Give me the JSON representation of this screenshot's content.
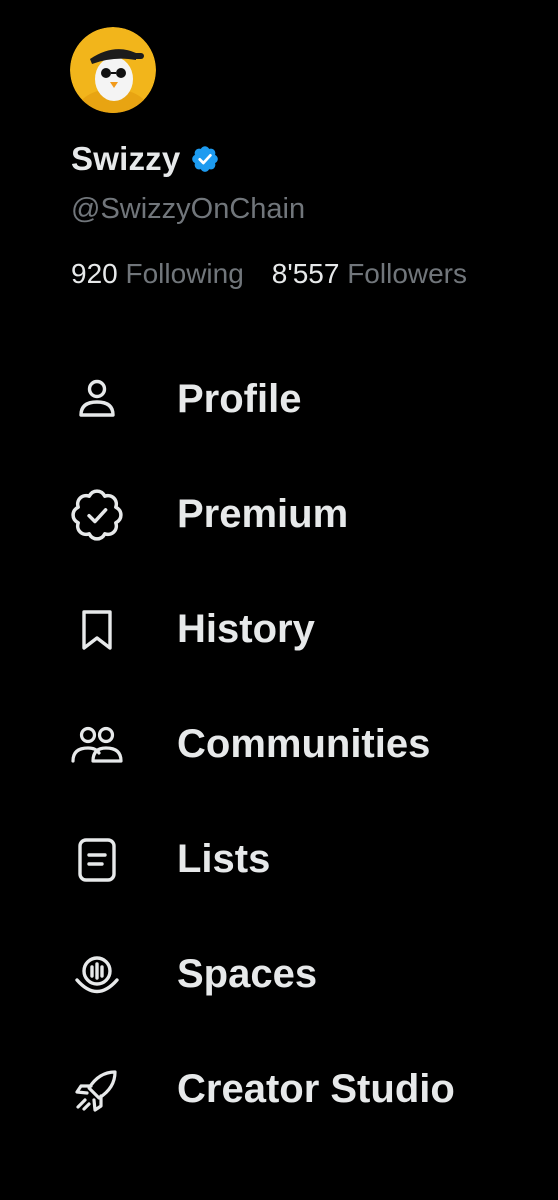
{
  "profile": {
    "display_name": "Swizzy",
    "handle": "@SwizzyOnChain",
    "verified": true,
    "avatar_icon": "penguin-avatar",
    "following_count": "920",
    "following_label": "Following",
    "followers_count": "8'557",
    "followers_label": "Followers"
  },
  "menu": {
    "items": [
      {
        "label": "Profile",
        "icon": "person-icon"
      },
      {
        "label": "Premium",
        "icon": "verified-badge-icon"
      },
      {
        "label": "History",
        "icon": "bookmark-icon"
      },
      {
        "label": "Communities",
        "icon": "people-icon"
      },
      {
        "label": "Lists",
        "icon": "list-icon"
      },
      {
        "label": "Spaces",
        "icon": "microphone-icon"
      },
      {
        "label": "Creator Studio",
        "icon": "rocket-icon"
      }
    ]
  },
  "colors": {
    "background": "#000000",
    "text_primary": "#e7e9ea",
    "text_secondary": "#71767b",
    "verified_blue": "#1d9bf0",
    "avatar_yellow": "#f2b51b"
  }
}
